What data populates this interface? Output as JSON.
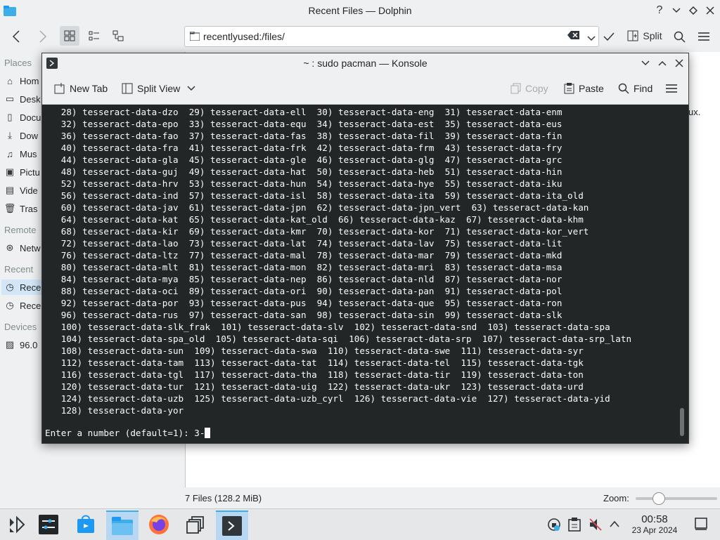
{
  "dolphin": {
    "title": "Recent Files — Dolphin",
    "url": "recentlyused:/files/",
    "split_label": "Split",
    "places_header": "Places",
    "places": [
      "Home",
      "Desktop",
      "Documents",
      "Downloads",
      "Music",
      "Pictures",
      "Videos",
      "Trash"
    ],
    "places_visible": [
      "Hom",
      "Desk",
      "Docu",
      "Dow",
      "Mus",
      "Pictu",
      "Vide",
      "Tras"
    ],
    "remote_header": "Remote",
    "remote_items": [
      "Netw"
    ],
    "recent_header": "Recent",
    "recent_items": [
      "Rece",
      "Rece"
    ],
    "devices_header": "Devices",
    "devices_items": [
      "96.0"
    ],
    "peek_text": "ux.",
    "status": "7 Files (128.2 MiB)",
    "zoom_label": "Zoom:"
  },
  "konsole": {
    "title": "~ : sudo pacman — Konsole",
    "toolbar": {
      "new_tab": "New Tab",
      "split_view": "Split View",
      "copy": "Copy",
      "paste": "Paste",
      "find": "Find"
    },
    "lines": [
      "   28) tesseract-data-dzo  29) tesseract-data-ell  30) tesseract-data-eng  31) tesseract-data-enm",
      "   32) tesseract-data-epo  33) tesseract-data-equ  34) tesseract-data-est  35) tesseract-data-eus",
      "   36) tesseract-data-fao  37) tesseract-data-fas  38) tesseract-data-fil  39) tesseract-data-fin",
      "   40) tesseract-data-fra  41) tesseract-data-frk  42) tesseract-data-frm  43) tesseract-data-fry",
      "   44) tesseract-data-gla  45) tesseract-data-gle  46) tesseract-data-glg  47) tesseract-data-grc",
      "   48) tesseract-data-guj  49) tesseract-data-hat  50) tesseract-data-heb  51) tesseract-data-hin",
      "   52) tesseract-data-hrv  53) tesseract-data-hun  54) tesseract-data-hye  55) tesseract-data-iku",
      "   56) tesseract-data-ind  57) tesseract-data-isl  58) tesseract-data-ita  59) tesseract-data-ita_old",
      "   60) tesseract-data-jav  61) tesseract-data-jpn  62) tesseract-data-jpn_vert  63) tesseract-data-kan",
      "   64) tesseract-data-kat  65) tesseract-data-kat_old  66) tesseract-data-kaz  67) tesseract-data-khm",
      "   68) tesseract-data-kir  69) tesseract-data-kmr  70) tesseract-data-kor  71) tesseract-data-kor_vert",
      "   72) tesseract-data-lao  73) tesseract-data-lat  74) tesseract-data-lav  75) tesseract-data-lit",
      "   76) tesseract-data-ltz  77) tesseract-data-mal  78) tesseract-data-mar  79) tesseract-data-mkd",
      "   80) tesseract-data-mlt  81) tesseract-data-mon  82) tesseract-data-mri  83) tesseract-data-msa",
      "   84) tesseract-data-mya  85) tesseract-data-nep  86) tesseract-data-nld  87) tesseract-data-nor",
      "   88) tesseract-data-oci  89) tesseract-data-ori  90) tesseract-data-pan  91) tesseract-data-pol",
      "   92) tesseract-data-por  93) tesseract-data-pus  94) tesseract-data-que  95) tesseract-data-ron",
      "   96) tesseract-data-rus  97) tesseract-data-san  98) tesseract-data-sin  99) tesseract-data-slk",
      "   100) tesseract-data-slk_frak  101) tesseract-data-slv  102) tesseract-data-snd  103) tesseract-data-spa",
      "   104) tesseract-data-spa_old  105) tesseract-data-sqi  106) tesseract-data-srp  107) tesseract-data-srp_latn",
      "   108) tesseract-data-sun  109) tesseract-data-swa  110) tesseract-data-swe  111) tesseract-data-syr",
      "   112) tesseract-data-tam  113) tesseract-data-tat  114) tesseract-data-tel  115) tesseract-data-tgk",
      "   116) tesseract-data-tgl  117) tesseract-data-tha  118) tesseract-data-tir  119) tesseract-data-ton",
      "   120) tesseract-data-tur  121) tesseract-data-uig  122) tesseract-data-ukr  123) tesseract-data-urd",
      "   124) tesseract-data-uzb  125) tesseract-data-uzb_cyrl  126) tesseract-data-vie  127) tesseract-data-yid",
      "   128) tesseract-data-yor"
    ],
    "prompt": "Enter a number (default=1): 3-"
  },
  "taskbar": {
    "time": "00:58",
    "date": "23 Apr 2024"
  },
  "icons": [
    "app-launcher-icon",
    "system-settings-icon",
    "discover-icon",
    "dolphin-icon",
    "firefox-icon",
    "window-overview-icon",
    "konsole-icon"
  ]
}
